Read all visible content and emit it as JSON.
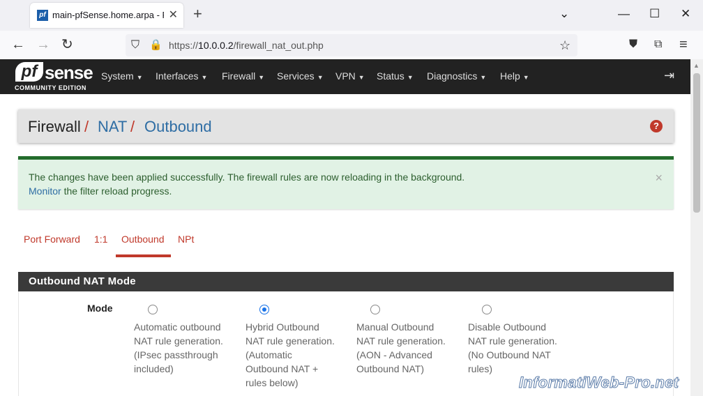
{
  "browser": {
    "tab_title": "main-pfSense.home.arpa - Firewall",
    "favicon_text": "pf",
    "url_prefix": "https://",
    "url_host": "10.0.0.2",
    "url_path": "/firewall_nat_out.php"
  },
  "logo": {
    "pf": "pf",
    "sense": "sense",
    "edition": "COMMUNITY EDITION"
  },
  "menu": {
    "items": [
      "System",
      "Interfaces",
      "Firewall",
      "Services",
      "VPN",
      "Status",
      "Diagnostics",
      "Help"
    ]
  },
  "breadcrumb": {
    "root": "Firewall",
    "sep1": "/",
    "level2": "NAT",
    "sep2": "/",
    "level3": "Outbound"
  },
  "alert": {
    "line1": "The changes have been applied successfully. The firewall rules are now reloading in the background.",
    "link": "Monitor",
    "line2_rest": " the filter reload progress."
  },
  "tabs": [
    "Port Forward",
    "1:1",
    "Outbound",
    "NPt"
  ],
  "active_tab": "Outbound",
  "panel": {
    "title": "Outbound NAT Mode",
    "mode_label": "Mode",
    "selected_option": 1,
    "options": [
      [
        "Automatic outbound",
        "NAT rule generation.",
        "(IPsec passthrough",
        "included)"
      ],
      [
        "Hybrid Outbound",
        "NAT rule generation.",
        "(Automatic",
        "Outbound NAT +",
        "rules below)"
      ],
      [
        "Manual Outbound",
        "NAT rule generation.",
        "(AON - Advanced",
        "Outbound NAT)"
      ],
      [
        "Disable Outbound",
        "NAT rule generation.",
        "(No Outbound NAT",
        "rules)"
      ]
    ]
  },
  "watermark": "InformatiWeb-Pro.net"
}
